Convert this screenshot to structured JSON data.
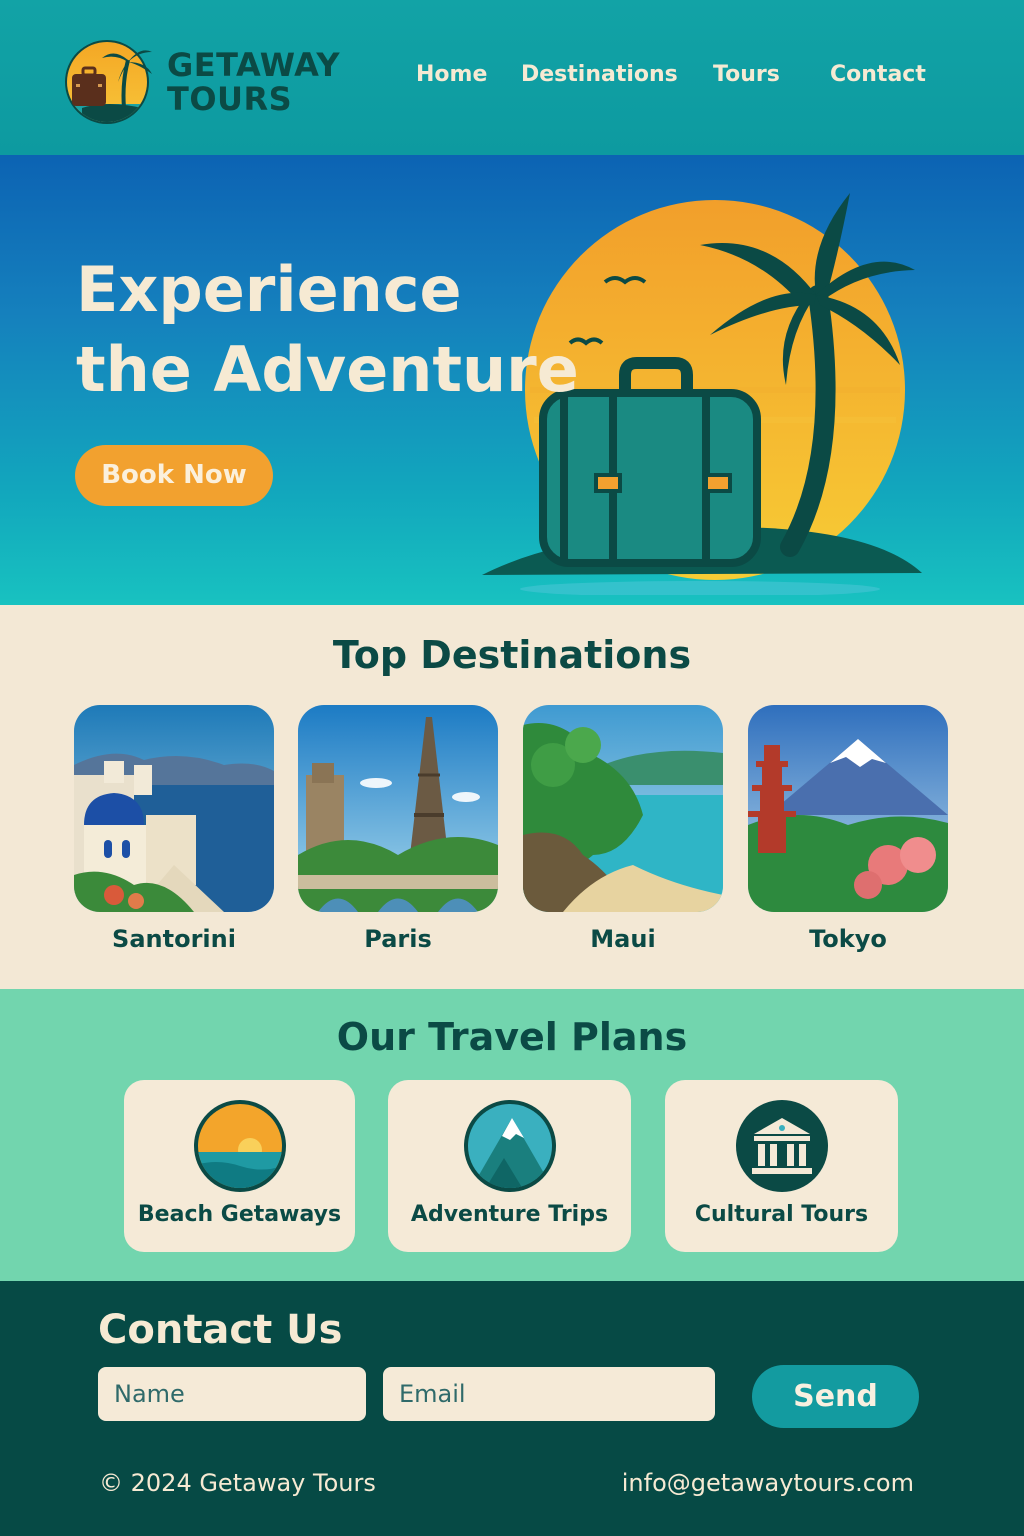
{
  "header": {
    "brand_line1": "GETAWAY",
    "brand_line2": "TOURS",
    "nav": [
      "Home",
      "Destinations",
      "Tours",
      "Contact"
    ]
  },
  "hero": {
    "title_line1": "Experience",
    "title_line2": "the Adventure",
    "cta_label": "Book Now"
  },
  "destinations": {
    "title": "Top Destinations",
    "items": [
      {
        "label": "Santorini",
        "icon": "santorini-image"
      },
      {
        "label": "Paris",
        "icon": "eiffel-tower-image"
      },
      {
        "label": "Maui",
        "icon": "tropical-coast-image"
      },
      {
        "label": "Tokyo",
        "icon": "mount-fuji-pagoda-image"
      }
    ]
  },
  "plans": {
    "title": "Our Travel Plans",
    "items": [
      {
        "label": "Beach Getaways",
        "icon": "beach-sunset-icon"
      },
      {
        "label": "Adventure Trips",
        "icon": "mountain-icon"
      },
      {
        "label": "Cultural Tours",
        "icon": "museum-icon"
      }
    ]
  },
  "contact": {
    "title": "Contact Us",
    "name_placeholder": "Name",
    "email_placeholder": "Email",
    "send_label": "Send"
  },
  "footer": {
    "copyright": "© 2024 Getaway Tours",
    "email": "info@getawaytours.com"
  },
  "colors": {
    "brand_dark": "#0b4a45",
    "accent_orange": "#f2a12f",
    "header_teal": "#12a3a6",
    "cream": "#f3e8d5",
    "mint": "#72d5ae"
  }
}
